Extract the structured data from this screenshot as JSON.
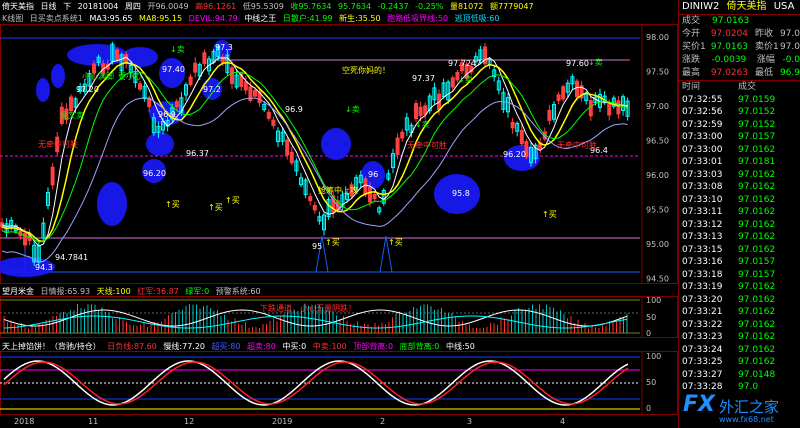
{
  "main_info": {
    "name": "倚天美指",
    "period": "日线",
    "dir": "下",
    "date": "20181004",
    "weekday": "周四",
    "open": "开96.0049",
    "high": "高96.1261",
    "low": "低95.5309",
    "close": "收95.7634",
    "last": "95.7634",
    "change": "-0.2437",
    "pct": "-0.25%",
    "vol": "量81072",
    "amount": "额7779047"
  },
  "ind_info": {
    "name": "K线图",
    "sub": "日买卖点系统1",
    "ma3": "MA3:95.65",
    "ma8": "MA8:95.15",
    "devil": "DEVIL:94.79",
    "king": "中线之王",
    "scatter": "日散户:41.99",
    "newgen": "新生:35.50",
    "dump": "跑路低吸界线:50",
    "overbought": "逃顶低吸:60"
  },
  "price_axis": [
    "98.00",
    "97.50",
    "97.00",
    "96.50",
    "96.00",
    "95.50",
    "95.00",
    "94.50"
  ],
  "annotations": {
    "p9720": "97.20",
    "p9740": "97.40",
    "p973": "97.3",
    "p972": "97.2",
    "p969": "96.9",
    "p969b": "96.9",
    "p9737": "97.37",
    "p97724": "97.7247",
    "p9760": "97.60",
    "p964": "96.4",
    "p9620": "96.20",
    "p9620b": "96.20",
    "p9637": "96.37",
    "p96": "96",
    "p958": "95.8",
    "p95": "95",
    "p9478": "94.7841",
    "p943": "94.3",
    "empty_bull": "空死你妈的！",
    "no_chase": "无牵中可胜",
    "no_chase2": "无牵中可胜",
    "no_chase3": "无牵中可胜",
    "catch": "抢筹中上攻",
    "sell1": "↓卖",
    "buy1": "↑买",
    "buy2": "↑买",
    "buy3": "↑买",
    "buy4": "↑买",
    "buy5": "↑买",
    "buy6": "↑买",
    "sell2": "↓卖",
    "sell3": "↓卖",
    "sell4": "↓卖",
    "sell5": "↓卖",
    "box_left": "小心满脚",
    "box_left2": "要小心",
    "gold_sell": "金叉卖"
  },
  "sub1": {
    "title": "望月米金",
    "a": "日情报:65.93",
    "b": "天线:100",
    "c": "红军:36.87",
    "d": "绿军:0",
    "e": "预警系统:60",
    "warn": "下跌通道，小心无量阴跌！",
    "axis": [
      "100",
      "50",
      "0"
    ]
  },
  "sub2": {
    "title": "天上掉馅饼！（背驰/持仓）",
    "a": "日负线:87.60",
    "b": "慢线:77.20",
    "c": "超买:80",
    "d": "超卖:80",
    "e": "中买:0",
    "f": "中卖:100",
    "g": "顶部背离:0",
    "h": "底部背离:0",
    "i": "中线:50",
    "axis": [
      "100",
      "50",
      "0"
    ]
  },
  "x_axis": [
    "2018",
    "11",
    "12",
    "2019",
    "2",
    "3",
    "4"
  ],
  "quote": {
    "title": "DINIW2",
    "name": "倚天美指",
    "market": "USA",
    "rows": [
      {
        "l": "成交",
        "v": "97.0163",
        "c": "#00ff00",
        "l2": "",
        "v2": "",
        "c2": ""
      },
      {
        "l": "今开",
        "v": "97.0204",
        "c": "#ff3030",
        "l2": "昨收",
        "v2": "97.0",
        "c2": "#c0c0c0"
      },
      {
        "l": "买价1",
        "v": "97.0163",
        "c": "#00ff00",
        "l2": "卖价1",
        "v2": "97.0",
        "c2": "#c0c0c0"
      },
      {
        "l": "涨跌",
        "v": "-0.0039",
        "c": "#00ff00",
        "l2": "涨幅",
        "v2": "-0.0",
        "c2": "#00ff00"
      },
      {
        "l": "最高",
        "v": "97.0263",
        "c": "#ff3030",
        "l2": "最低",
        "v2": "96.9",
        "c2": "#00ff00"
      }
    ],
    "tick_header": {
      "time": "时间",
      "price": "成交"
    },
    "ticks": [
      {
        "t": "07:32:55",
        "p": "97.0159"
      },
      {
        "t": "07:32:56",
        "p": "97.0152"
      },
      {
        "t": "07:32:59",
        "p": "97.0152"
      },
      {
        "t": "07:33:00",
        "p": "97.0157"
      },
      {
        "t": "07:33:00",
        "p": "97.0162"
      },
      {
        "t": "07:33:01",
        "p": "97.0181"
      },
      {
        "t": "07:33:03",
        "p": "97.0162"
      },
      {
        "t": "07:33:08",
        "p": "97.0162"
      },
      {
        "t": "07:33:10",
        "p": "97.0162"
      },
      {
        "t": "07:33:11",
        "p": "97.0162"
      },
      {
        "t": "07:33:12",
        "p": "97.0162"
      },
      {
        "t": "07:33:13",
        "p": "97.0162"
      },
      {
        "t": "07:33:15",
        "p": "97.0162"
      },
      {
        "t": "07:33:16",
        "p": "97.0157"
      },
      {
        "t": "07:33:18",
        "p": "97.0157"
      },
      {
        "t": "07:33:19",
        "p": "97.0162"
      },
      {
        "t": "07:33:20",
        "p": "97.0162"
      },
      {
        "t": "07:33:21",
        "p": "97.0162"
      },
      {
        "t": "07:33:22",
        "p": "97.0162"
      },
      {
        "t": "07:33:23",
        "p": "97.0162"
      },
      {
        "t": "07:33:24",
        "p": "97.0162"
      },
      {
        "t": "07:33:25",
        "p": "97.0162"
      },
      {
        "t": "07:33:27",
        "p": "97.0148"
      },
      {
        "t": "07:33:28",
        "p": "97.0"
      }
    ]
  },
  "watermark": "外汇之家",
  "watermark_fx": "FX",
  "watermark_url": "www.fx68.net",
  "colors": {
    "up": "#00ffff",
    "down": "#ff4040",
    "ma_yellow": "#ffff00",
    "ma_white": "#ffffff",
    "ma_green": "#00ff00",
    "bubble": "#1a1aff"
  }
}
